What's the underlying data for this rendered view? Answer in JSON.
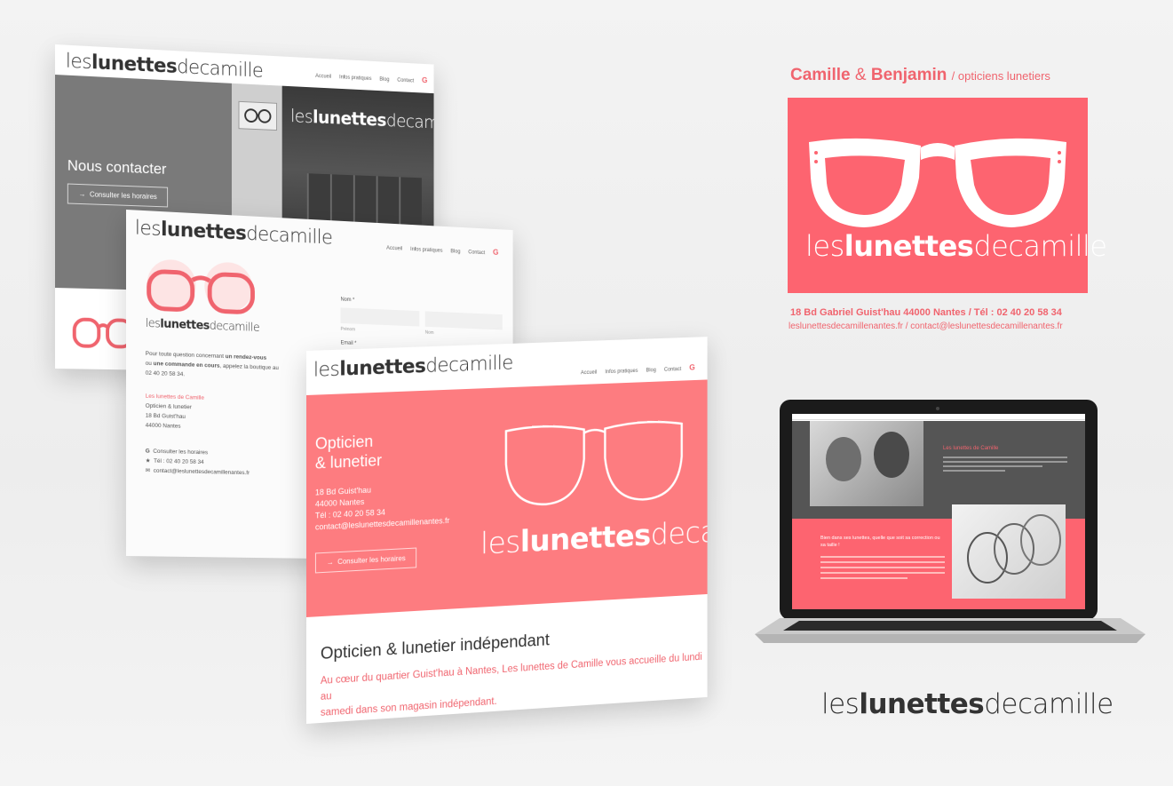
{
  "brand": {
    "logo_part1": "les",
    "logo_part2": "lunettes",
    "logo_part3": "decamille"
  },
  "nav": {
    "items": [
      "Accueil",
      "Infos pratiques",
      "Blog",
      "Contact"
    ],
    "g_icon": "G"
  },
  "panel1": {
    "heading": "Nous contacter",
    "button": "Consulter les horaires",
    "sign_logo_part1": "les",
    "sign_logo_part2": "lunettes",
    "sign_logo_part3": "decamille"
  },
  "panel2": {
    "form": {
      "name_label": "Nom *",
      "first_name_sub": "Prénom",
      "last_name_sub": "Nom",
      "email_label": "Email *"
    },
    "intro_text_1": "Pour toute question concernant ",
    "intro_bold_1": "un rendez-vous",
    "intro_text_2": "ou ",
    "intro_bold_2": "une commande en cours",
    "intro_text_3": ", appelez la boutique au",
    "intro_phone": "02 40 20 58 34.",
    "address_name": "Les lunettes de Camille",
    "address_line1": "Opticien & lunetier",
    "address_line2": "18 Bd Guist'hau",
    "address_line3": "44000 Nantes",
    "link_hours": "Consulter les horaires",
    "link_phone": "Tél : 02 40 20 58 34",
    "link_email": "contact@leslunettesdecamillenantes.fr"
  },
  "panel3": {
    "hero_title_1": "Opticien",
    "hero_title_2": "& lunetier",
    "hero_addr1": "18 Bd Guist'hau",
    "hero_addr2": "44000 Nantes",
    "hero_phone": "Tél : 02 40 20 58 34",
    "hero_email": "contact@leslunettesdecamillenantes.fr",
    "button": "Consulter les horaires",
    "section_title": "Opticien & lunetier indépendant",
    "section_text_1": "Au cœur du quartier Guist'hau à Nantes, Les lunettes de Camille vous accueille du lundi au",
    "section_text_2": "samedi dans son magasin indépendant."
  },
  "card": {
    "name1": "Camille",
    "amp": "&",
    "name2": "Benjamin",
    "tagline": "/ opticiens lunetiers",
    "address": "18 Bd Gabriel Guist'hau 44000 Nantes / Tél : 02 40 20 58 34",
    "emails": "leslunettesdecamillenantes.fr / contact@leslunettesdecamillenantes.fr"
  },
  "laptop": {
    "about_title": "Les lunettes de Camille",
    "quote_title": "Bien dans ses lunettes, quelle que soit sa correction ou sa taille !"
  },
  "colors": {
    "brand_pink": "#fd6470",
    "dark_gray": "#444444"
  }
}
